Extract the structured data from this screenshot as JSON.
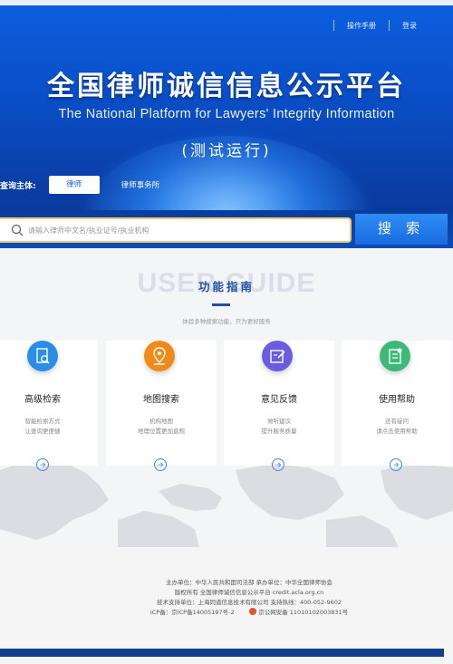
{
  "header": {
    "nav": [
      {
        "label": "操作手册"
      },
      {
        "label": "登录"
      }
    ],
    "title_cn": "全国律师诚信信息公示平台",
    "title_en": "The National Platform for  Lawyers' Integrity Information",
    "subtitle": "(测试运行)",
    "query": {
      "label": "查询主体:",
      "options": [
        "律师",
        "律师事务所"
      ],
      "selected": "律师"
    }
  },
  "search": {
    "placeholder": "请输入律师中文名/执业证号/执业机构",
    "button_label": "搜 索"
  },
  "guide": {
    "background_text": "USER GUIDE",
    "title": "功能指南",
    "subtitle": "体验多种搜索功能，只为更好服务",
    "cards": [
      {
        "title": "高级检索",
        "desc": [
          "智能检索方式",
          "让查询更便捷"
        ],
        "icon": "search-document-icon",
        "color": "#2a8de8"
      },
      {
        "title": "地图搜索",
        "desc": [
          "机构地图",
          "地理位置更加直观"
        ],
        "icon": "map-pin-icon",
        "color": "#f28a1a"
      },
      {
        "title": "意见反馈",
        "desc": [
          "倾听建议",
          "提升服务质量"
        ],
        "icon": "edit-feedback-icon",
        "color": "#6a5ce0"
      },
      {
        "title": "使用帮助",
        "desc": [
          "还有疑问",
          "请点击使用帮助"
        ],
        "icon": "help-document-icon",
        "color": "#3cb878"
      }
    ]
  },
  "footer": {
    "lines": [
      "主办单位：中华人民共和国司法部  承办单位：中华全国律师协会",
      "版权所有  全国律师诚信信息公示平台 credit.acla.org.cn",
      "技术支持单位：上海同道信息技术有限公司  支持热线：400-052-9602"
    ],
    "icp": "ICP备：京ICP备14005197号-2",
    "police": "京公网安备 11010102003831号"
  },
  "colors": {
    "primary": "#1a5fd0",
    "dark_blue": "#0e3e8c",
    "search_border": "#f0c96a"
  }
}
